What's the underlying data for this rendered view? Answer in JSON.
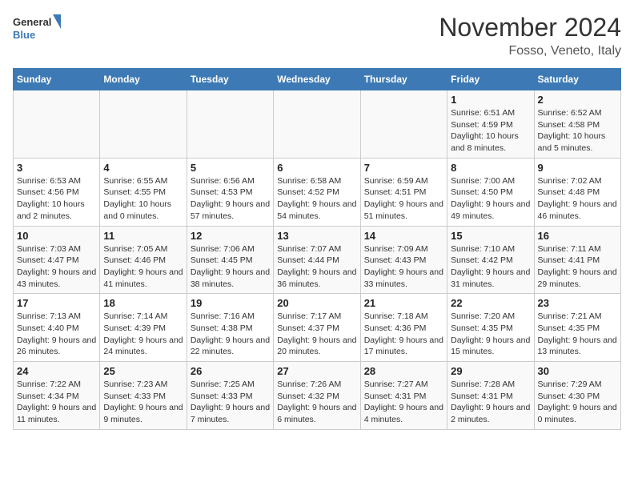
{
  "header": {
    "logo": {
      "general": "General",
      "blue": "Blue"
    },
    "title": "November 2024",
    "location": "Fosso, Veneto, Italy"
  },
  "weekdays": [
    "Sunday",
    "Monday",
    "Tuesday",
    "Wednesday",
    "Thursday",
    "Friday",
    "Saturday"
  ],
  "weeks": [
    [
      {
        "day": "",
        "info": ""
      },
      {
        "day": "",
        "info": ""
      },
      {
        "day": "",
        "info": ""
      },
      {
        "day": "",
        "info": ""
      },
      {
        "day": "",
        "info": ""
      },
      {
        "day": "1",
        "info": "Sunrise: 6:51 AM\nSunset: 4:59 PM\nDaylight: 10 hours and 8 minutes."
      },
      {
        "day": "2",
        "info": "Sunrise: 6:52 AM\nSunset: 4:58 PM\nDaylight: 10 hours and 5 minutes."
      }
    ],
    [
      {
        "day": "3",
        "info": "Sunrise: 6:53 AM\nSunset: 4:56 PM\nDaylight: 10 hours and 2 minutes."
      },
      {
        "day": "4",
        "info": "Sunrise: 6:55 AM\nSunset: 4:55 PM\nDaylight: 10 hours and 0 minutes."
      },
      {
        "day": "5",
        "info": "Sunrise: 6:56 AM\nSunset: 4:53 PM\nDaylight: 9 hours and 57 minutes."
      },
      {
        "day": "6",
        "info": "Sunrise: 6:58 AM\nSunset: 4:52 PM\nDaylight: 9 hours and 54 minutes."
      },
      {
        "day": "7",
        "info": "Sunrise: 6:59 AM\nSunset: 4:51 PM\nDaylight: 9 hours and 51 minutes."
      },
      {
        "day": "8",
        "info": "Sunrise: 7:00 AM\nSunset: 4:50 PM\nDaylight: 9 hours and 49 minutes."
      },
      {
        "day": "9",
        "info": "Sunrise: 7:02 AM\nSunset: 4:48 PM\nDaylight: 9 hours and 46 minutes."
      }
    ],
    [
      {
        "day": "10",
        "info": "Sunrise: 7:03 AM\nSunset: 4:47 PM\nDaylight: 9 hours and 43 minutes."
      },
      {
        "day": "11",
        "info": "Sunrise: 7:05 AM\nSunset: 4:46 PM\nDaylight: 9 hours and 41 minutes."
      },
      {
        "day": "12",
        "info": "Sunrise: 7:06 AM\nSunset: 4:45 PM\nDaylight: 9 hours and 38 minutes."
      },
      {
        "day": "13",
        "info": "Sunrise: 7:07 AM\nSunset: 4:44 PM\nDaylight: 9 hours and 36 minutes."
      },
      {
        "day": "14",
        "info": "Sunrise: 7:09 AM\nSunset: 4:43 PM\nDaylight: 9 hours and 33 minutes."
      },
      {
        "day": "15",
        "info": "Sunrise: 7:10 AM\nSunset: 4:42 PM\nDaylight: 9 hours and 31 minutes."
      },
      {
        "day": "16",
        "info": "Sunrise: 7:11 AM\nSunset: 4:41 PM\nDaylight: 9 hours and 29 minutes."
      }
    ],
    [
      {
        "day": "17",
        "info": "Sunrise: 7:13 AM\nSunset: 4:40 PM\nDaylight: 9 hours and 26 minutes."
      },
      {
        "day": "18",
        "info": "Sunrise: 7:14 AM\nSunset: 4:39 PM\nDaylight: 9 hours and 24 minutes."
      },
      {
        "day": "19",
        "info": "Sunrise: 7:16 AM\nSunset: 4:38 PM\nDaylight: 9 hours and 22 minutes."
      },
      {
        "day": "20",
        "info": "Sunrise: 7:17 AM\nSunset: 4:37 PM\nDaylight: 9 hours and 20 minutes."
      },
      {
        "day": "21",
        "info": "Sunrise: 7:18 AM\nSunset: 4:36 PM\nDaylight: 9 hours and 17 minutes."
      },
      {
        "day": "22",
        "info": "Sunrise: 7:20 AM\nSunset: 4:35 PM\nDaylight: 9 hours and 15 minutes."
      },
      {
        "day": "23",
        "info": "Sunrise: 7:21 AM\nSunset: 4:35 PM\nDaylight: 9 hours and 13 minutes."
      }
    ],
    [
      {
        "day": "24",
        "info": "Sunrise: 7:22 AM\nSunset: 4:34 PM\nDaylight: 9 hours and 11 minutes."
      },
      {
        "day": "25",
        "info": "Sunrise: 7:23 AM\nSunset: 4:33 PM\nDaylight: 9 hours and 9 minutes."
      },
      {
        "day": "26",
        "info": "Sunrise: 7:25 AM\nSunset: 4:33 PM\nDaylight: 9 hours and 7 minutes."
      },
      {
        "day": "27",
        "info": "Sunrise: 7:26 AM\nSunset: 4:32 PM\nDaylight: 9 hours and 6 minutes."
      },
      {
        "day": "28",
        "info": "Sunrise: 7:27 AM\nSunset: 4:31 PM\nDaylight: 9 hours and 4 minutes."
      },
      {
        "day": "29",
        "info": "Sunrise: 7:28 AM\nSunset: 4:31 PM\nDaylight: 9 hours and 2 minutes."
      },
      {
        "day": "30",
        "info": "Sunrise: 7:29 AM\nSunset: 4:30 PM\nDaylight: 9 hours and 0 minutes."
      }
    ]
  ]
}
